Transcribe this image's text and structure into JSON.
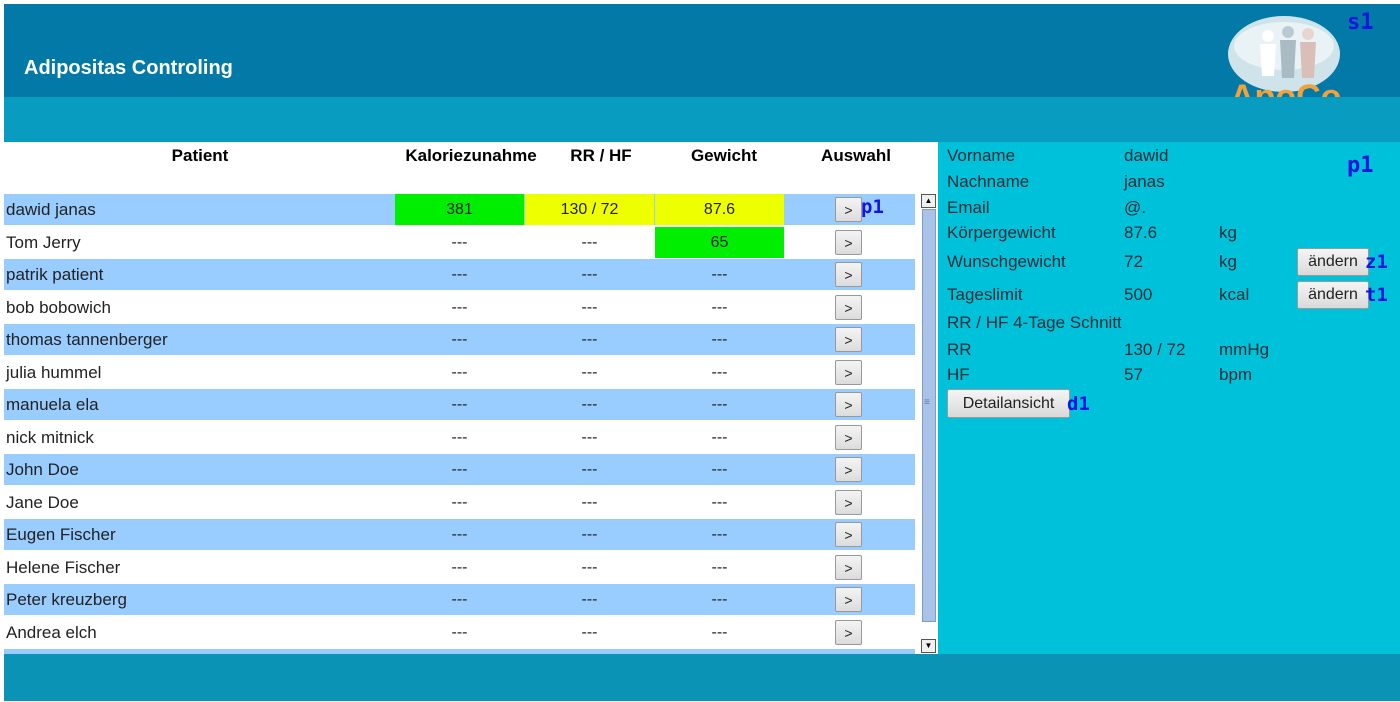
{
  "header": {
    "title": "Adipositas Controling",
    "logo_text": "ApoCo"
  },
  "labels": {
    "s1": "s1",
    "p1_panel": "p1",
    "p1_row": "p1",
    "z1": "z1",
    "t1": "t1",
    "d1": "d1"
  },
  "table": {
    "columns": [
      "Patient",
      "Kaloriezunahme",
      "RR / HF",
      "Gewicht",
      "Auswahl"
    ],
    "select_label": ">",
    "rows": [
      {
        "name": "dawid janas",
        "kalorie": "381",
        "rrhf": "130 / 72",
        "gewicht": "87.6"
      },
      {
        "name": "Tom Jerry",
        "kalorie": "---",
        "rrhf": "---",
        "gewicht": "65"
      },
      {
        "name": "patrik patient",
        "kalorie": "---",
        "rrhf": "---",
        "gewicht": "---"
      },
      {
        "name": "bob bobowich",
        "kalorie": "---",
        "rrhf": "---",
        "gewicht": "---"
      },
      {
        "name": "thomas tannenberger",
        "kalorie": "---",
        "rrhf": "---",
        "gewicht": "---"
      },
      {
        "name": "julia hummel",
        "kalorie": "---",
        "rrhf": "---",
        "gewicht": "---"
      },
      {
        "name": "manuela ela",
        "kalorie": "---",
        "rrhf": "---",
        "gewicht": "---"
      },
      {
        "name": "nick mitnick",
        "kalorie": "---",
        "rrhf": "---",
        "gewicht": "---"
      },
      {
        "name": "John Doe",
        "kalorie": "---",
        "rrhf": "---",
        "gewicht": "---"
      },
      {
        "name": "Jane Doe",
        "kalorie": "---",
        "rrhf": "---",
        "gewicht": "---"
      },
      {
        "name": "Eugen Fischer",
        "kalorie": "---",
        "rrhf": "---",
        "gewicht": "---"
      },
      {
        "name": "Helene Fischer",
        "kalorie": "---",
        "rrhf": "---",
        "gewicht": "---"
      },
      {
        "name": "Peter kreuzberg",
        "kalorie": "---",
        "rrhf": "---",
        "gewicht": "---"
      },
      {
        "name": "Andrea elch",
        "kalorie": "---",
        "rrhf": "---",
        "gewicht": "---"
      }
    ]
  },
  "detail": {
    "vorname_label": "Vorname",
    "vorname": "dawid",
    "nachname_label": "Nachname",
    "nachname": "janas",
    "email_label": "Email",
    "email": "@.",
    "koerpergewicht_label": "Körpergewicht",
    "koerpergewicht": "87.6",
    "koerpergewicht_unit": "kg",
    "wunschgewicht_label": "Wunschgewicht",
    "wunschgewicht": "72",
    "wunschgewicht_unit": "kg",
    "tageslimit_label": "Tageslimit",
    "tageslimit": "500",
    "tageslimit_unit": "kcal",
    "aendern_label": "ändern",
    "schnitt_label": "RR / HF 4-Tage Schnitt",
    "rr_label": "RR",
    "rr": "130 / 72",
    "rr_unit": "mmHg",
    "hf_label": "HF",
    "hf": "57",
    "hf_unit": "bpm",
    "detail_button": "Detailansicht"
  },
  "colors": {
    "header": "#0379a8",
    "subbar": "#079cc0",
    "detail_bg": "#00c1da",
    "row_alt": "#99ccff",
    "highlight_green": "#00ee00",
    "highlight_yellow": "#eeff00",
    "label_blue": "#1515e0"
  }
}
